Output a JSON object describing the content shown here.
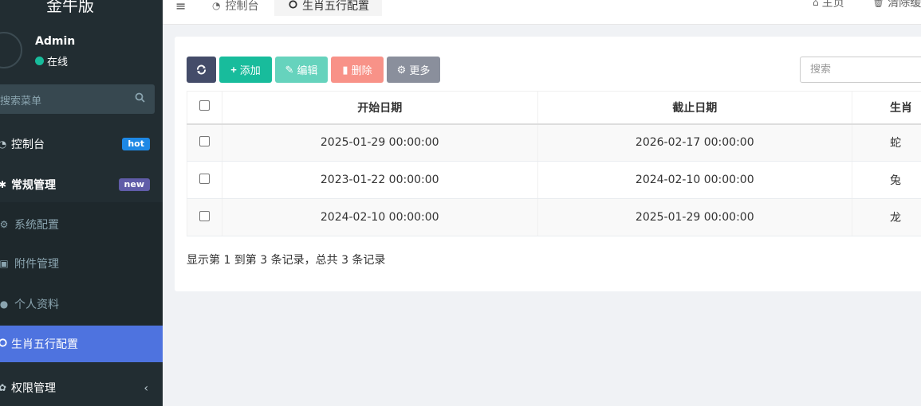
{
  "brand": {
    "title": "金牛版"
  },
  "user": {
    "name": "Admin",
    "status": "在线"
  },
  "sidebar": {
    "search_placeholder": "搜索菜单",
    "items": [
      {
        "label": "控制台",
        "icon": "dashboard-icon",
        "badge": "hot"
      },
      {
        "label": "常规管理",
        "icon": "cogs-icon",
        "badge": "new"
      },
      {
        "label": "系统配置",
        "icon": "gear-icon"
      },
      {
        "label": "附件管理",
        "icon": "file-image-icon"
      },
      {
        "label": "个人资料",
        "icon": "user-icon"
      },
      {
        "label": "生肖五行配置",
        "icon": "circle-icon"
      },
      {
        "label": "权限管理",
        "icon": "group-icon"
      }
    ]
  },
  "header": {
    "tabs": [
      {
        "label": "控制台",
        "icon": "dashboard-icon"
      },
      {
        "label": "生肖五行配置",
        "icon": "circle-icon"
      }
    ],
    "home_label": "主页",
    "clear_cache_label": "清除缓存"
  },
  "toolbar": {
    "add_label": "添加",
    "edit_label": "编辑",
    "delete_label": "删除",
    "more_label": "更多",
    "search_placeholder": "搜索"
  },
  "table": {
    "headers": [
      "开始日期",
      "截止日期",
      "生肖"
    ],
    "rows": [
      [
        "2025-01-29 00:00:00",
        "2026-02-17 00:00:00",
        "蛇"
      ],
      [
        "2023-01-22 00:00:00",
        "2024-02-10 00:00:00",
        "兔"
      ],
      [
        "2024-02-10 00:00:00",
        "2025-01-29 00:00:00",
        "龙"
      ]
    ]
  },
  "pagination_text": "显示第 1 到第 3 条记录，总共 3 条记录",
  "colors": {
    "sidebar_bg": "#222d32",
    "active_menu": "#4e73df",
    "success": "#18bc9c",
    "danger": "#f89288"
  }
}
